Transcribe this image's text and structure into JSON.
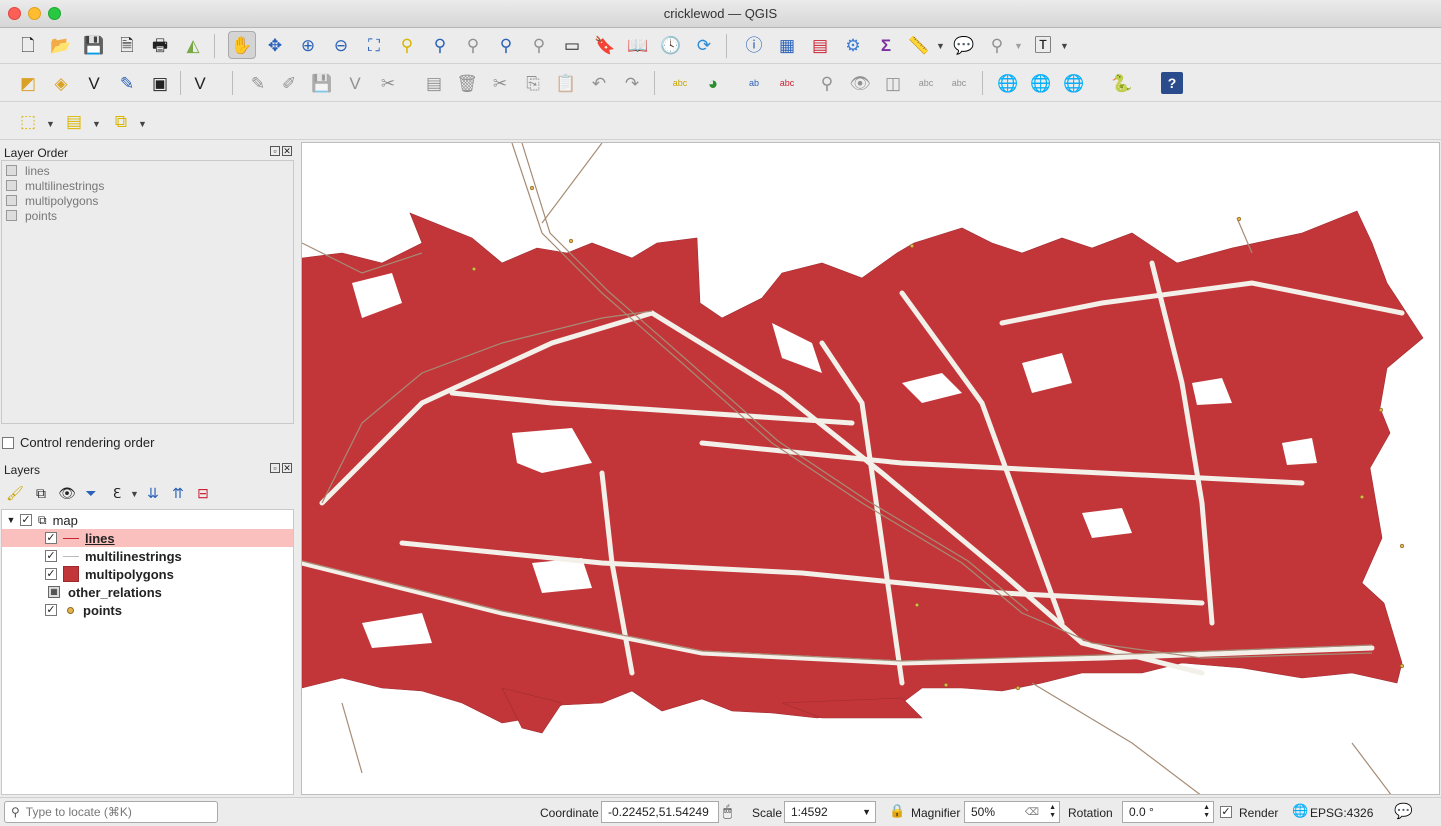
{
  "window": {
    "title": "cricklewod — QGIS"
  },
  "toolbar1": {
    "icons": [
      "new-project-icon",
      "open-project-icon",
      "save-project-icon",
      "save-as-icon",
      "print-layout-icon",
      "style-manager-icon",
      "pan-icon",
      "pan-to-selection-icon",
      "zoom-in-icon",
      "zoom-out-icon",
      "zoom-full-icon",
      "zoom-to-selection-icon",
      "zoom-to-layer-icon",
      "zoom-native-icon",
      "zoom-last-icon",
      "zoom-next-icon",
      "new-map-view-icon",
      "new-bookmark-icon",
      "show-bookmarks-icon",
      "temporal-controller-icon",
      "refresh-icon",
      "identify-icon",
      "attribute-table-icon",
      "field-calculator-icon",
      "processing-toolbox-icon",
      "statistics-icon",
      "measure-icon",
      "map-tips-icon",
      "select-by-location-icon",
      "text-annotation-icon"
    ]
  },
  "layer_order": {
    "title": "Layer Order",
    "items": [
      "lines",
      "multilinestrings",
      "multipolygons",
      "points"
    ],
    "control_label": "Control rendering order"
  },
  "layers": {
    "title": "Layers",
    "group": "map",
    "items": [
      {
        "name": "lines",
        "selected": true,
        "checked": true
      },
      {
        "name": "multilinestrings",
        "selected": false,
        "checked": true
      },
      {
        "name": "multipolygons",
        "selected": false,
        "checked": true
      },
      {
        "name": "other_relations",
        "selected": false,
        "checked": false
      },
      {
        "name": "points",
        "selected": false,
        "checked": true
      }
    ]
  },
  "colors": {
    "polygon_fill": "#c2363a",
    "road": "#a58c76",
    "selected_row": "#f9c0bd"
  },
  "status": {
    "locate_placeholder": "Type to locate (⌘K)",
    "coordinate_label": "Coordinate",
    "coordinate_value": "-0.22452,51.54249",
    "scale_label": "Scale",
    "scale_value": "1:4592",
    "magnifier_label": "Magnifier",
    "magnifier_value": "50%",
    "rotation_label": "Rotation",
    "rotation_value": "0.0 °",
    "render_label": "Render",
    "crs": "EPSG:4326"
  }
}
